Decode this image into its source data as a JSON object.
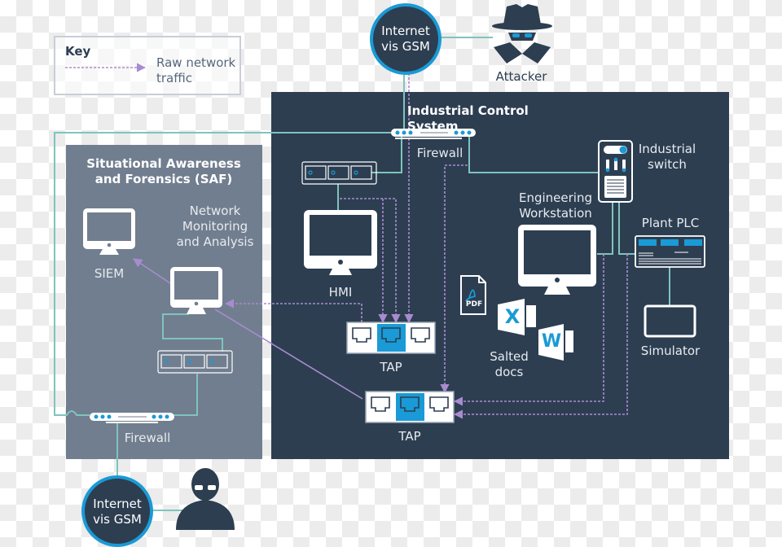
{
  "key": {
    "title": "Key",
    "legend_label_line1": "Raw network",
    "legend_label_line2": "traffic"
  },
  "top_internet": {
    "line1": "Internet",
    "line2": "vis GSM"
  },
  "attacker": {
    "label": "Attacker"
  },
  "ics": {
    "title": "Industrial Control System",
    "firewall_label": "Firewall",
    "industrial_switch": {
      "line1": "Industrial",
      "line2": "switch"
    },
    "engineering_workstation": {
      "line1": "Engineering",
      "line2": "Workstation"
    },
    "plant_plc": "Plant PLC",
    "hmi": "HMI",
    "simulator": "Simulator",
    "tap_upper": "TAP",
    "tap_lower": "TAP",
    "salted_docs": {
      "line1": "Salted",
      "line2": "docs",
      "pdf_text": "PDF",
      "excel_letter": "X",
      "word_letter": "W"
    }
  },
  "saf": {
    "title_line1": "Situational Awareness",
    "title_line2": "and Forensics (SAF)",
    "siem": "SIEM",
    "nma": {
      "line1": "Network",
      "line2": "Monitoring",
      "line3": "and Analysis"
    },
    "firewall_label": "Firewall"
  },
  "bottom_internet": {
    "line1": "Internet",
    "line2": "vis GSM"
  },
  "colors": {
    "ics_panel": "#2d3e51",
    "saf_panel": "#717e8f",
    "accent_blue": "#1a9ad6",
    "connection_teal": "#7fc4bd",
    "traffic_purple": "#a98bd1"
  }
}
